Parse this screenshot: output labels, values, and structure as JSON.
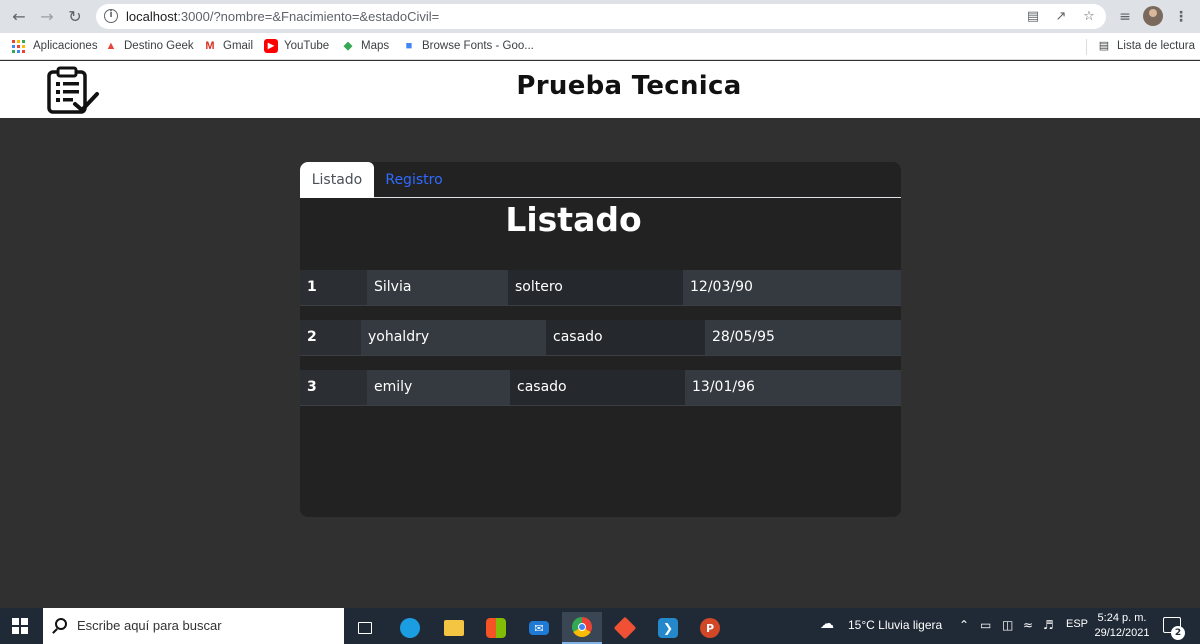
{
  "browser": {
    "url_host": "localhost",
    "url_rest": ":3000/?nombre=&Fnacimiento=&estadoCivil=",
    "bookmarks": [
      {
        "label": "Aplicaciones",
        "icon": "apps-grid-icon"
      },
      {
        "label": "Destino Geek",
        "icon": "rocket-icon",
        "color": "#e8453c"
      },
      {
        "label": "Gmail",
        "icon": "gmail-icon",
        "color": "#d93025"
      },
      {
        "label": "YouTube",
        "icon": "youtube-icon",
        "color": "#ff0000"
      },
      {
        "label": "Maps",
        "icon": "maps-icon",
        "color": "#34a853"
      },
      {
        "label": "Browse Fonts - Goo...",
        "icon": "google-fonts-icon",
        "color": "#4285f4"
      }
    ],
    "reading_list": "Lista de lectura"
  },
  "header": {
    "title": "Prueba Tecnica",
    "logo_icon": "clipboard-check-icon"
  },
  "card": {
    "tabs": [
      {
        "label": "Listado",
        "active": true
      },
      {
        "label": "Registro",
        "active": false,
        "color": "#2f6bff"
      }
    ],
    "heading": "Listado",
    "rows": [
      {
        "num": "1",
        "nombre": "Silvia",
        "estado": "soltero",
        "fecha": "12/03/90"
      },
      {
        "num": "2",
        "nombre": "yohaldry",
        "estado": "casado",
        "fecha": "28/05/95"
      },
      {
        "num": "3",
        "nombre": "emily",
        "estado": "casado",
        "fecha": "13/01/96"
      }
    ]
  },
  "taskbar": {
    "search_placeholder": "Escribe aquí para buscar",
    "weather": "15°C  Lluvia ligera",
    "lang": "ESP",
    "time": "5:24 p. m.",
    "date": "29/12/2021",
    "notifications": "2"
  }
}
